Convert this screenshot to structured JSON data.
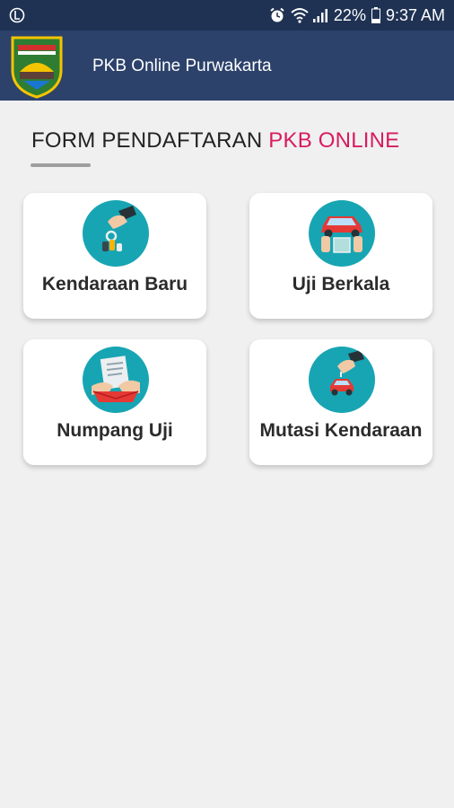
{
  "status_bar": {
    "battery_percent": "22%",
    "time": "9:37 AM",
    "icons": [
      "notification-icon",
      "alarm-icon",
      "wifi-icon",
      "signal-icon",
      "battery-icon"
    ]
  },
  "app_bar": {
    "title": "PKB Online Purwakarta",
    "logo": "purwakarta-logo"
  },
  "page": {
    "heading_main": "FORM PENDAFTARAN ",
    "heading_accent": "PKB ONLINE"
  },
  "menu": [
    {
      "label": "Kendaraan Baru",
      "icon": "car-key-icon"
    },
    {
      "label": "Uji Berkala",
      "icon": "car-inspection-icon"
    },
    {
      "label": "Numpang Uji",
      "icon": "document-handover-icon"
    },
    {
      "label": "Mutasi Kendaraan",
      "icon": "car-transfer-icon"
    }
  ],
  "colors": {
    "status_bar": "#1f3253",
    "app_bar": "#2c426b",
    "accent": "#d81b60",
    "icon_circle": "#17a5b3",
    "background": "#f0f0f0"
  }
}
